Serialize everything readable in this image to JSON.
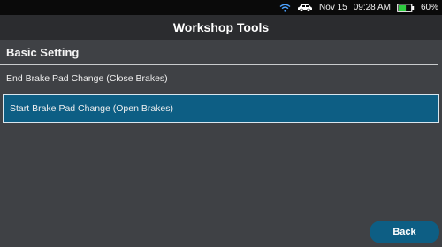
{
  "status_bar": {
    "wifi_icon": "wifi-icon",
    "car_icon": "car-icon",
    "date": "Nov 15",
    "time": "09:28 AM",
    "battery_icon": "battery-icon",
    "battery_level": 0.6,
    "battery_percent": "60%",
    "battery_color": "#2ecc40"
  },
  "header": {
    "title": "Workshop Tools"
  },
  "section": {
    "title": "Basic Setting"
  },
  "items": [
    {
      "label": "End Brake Pad Change (Close Brakes)",
      "selected": false
    },
    {
      "label": "Start Brake Pad Change (Open Brakes)",
      "selected": true
    }
  ],
  "footer": {
    "back_label": "Back"
  },
  "colors": {
    "accent": "#0d5e84",
    "background": "#3f4145",
    "title_bar": "#2b2c2f",
    "status_bar": "#0a0a0a"
  }
}
